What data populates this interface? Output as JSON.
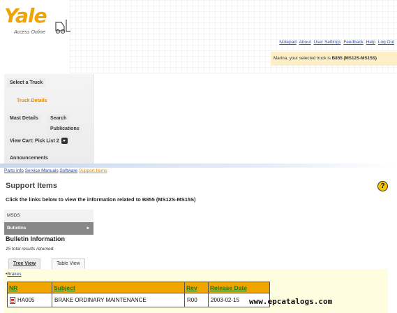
{
  "brand": {
    "name": "Yale",
    "tagline": "Access Online"
  },
  "top_links": [
    "Notepad",
    "About",
    "User Settings",
    "Feedback",
    "Help",
    "Log Out"
  ],
  "truck_bar": {
    "prefix": "Marina, your selected truck is ",
    "truck": "B855 (MS12S-MS15S)"
  },
  "nav": {
    "select_truck": "Select a Truck",
    "truck_details": "Truck Details",
    "mast_details": "Mast Details",
    "search": "Search",
    "publications": "Publications",
    "view_cart": "View Cart: Pick List 2",
    "announcements": "Announcements"
  },
  "section_tabs": [
    {
      "label": "Parts Info",
      "current": false
    },
    {
      "label": "Service Manuals",
      "current": false
    },
    {
      "label": "Software",
      "current": false
    },
    {
      "label": "Support Items",
      "current": true
    }
  ],
  "page": {
    "title": "Support Items",
    "instruction": "Click the links below to view the information related to B855 (MS12S-MS15S)",
    "help_glyph": "?"
  },
  "submenu": [
    {
      "label": "MSDS",
      "active": false
    },
    {
      "label": "Bulletins",
      "active": true
    }
  ],
  "bulletin": {
    "title": "Bulletin Information",
    "results_text": "15 total results returned."
  },
  "view_tabs": {
    "tree": "Tree View",
    "table": "Table View"
  },
  "group": {
    "name": "Brakes"
  },
  "table": {
    "headers": [
      "NR",
      "Subject",
      "Rev",
      "Release Date"
    ],
    "rows": [
      {
        "nr": "HA005",
        "subject": "BRAKE ORDINARY MAINTENANCE",
        "rev": "R00",
        "date": "2003-02-15"
      }
    ]
  },
  "watermark": "www.epcatalogs.com",
  "colors": {
    "accent": "#f0a400",
    "link": "#2a4ea8",
    "header_link": "#1a7a10",
    "panel": "#fffde0"
  }
}
